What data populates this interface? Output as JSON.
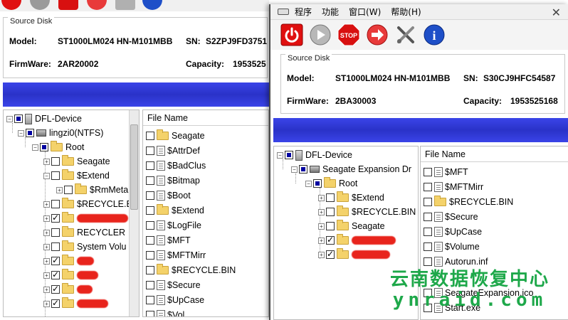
{
  "back_window": {
    "source_disk": {
      "legend": "Source Disk",
      "model_label": "Model:",
      "model_value": "ST1000LM024 HN-M101MBB",
      "sn_label": "SN:",
      "sn_value": "S2ZPJ9FD3751",
      "firmware_label": "FirmWare:",
      "firmware_value": "2AR20002",
      "capacity_label": "Capacity:",
      "capacity_value": "1953525"
    },
    "tree": {
      "device": "DFL-Device",
      "partition": "lingzi0(NTFS)",
      "root": "Root",
      "items": [
        "Seagate",
        "$Extend",
        "$RmMeta",
        "$RECYCLE.BIN",
        "RECYCLER",
        "System Volu"
      ]
    },
    "file_list": {
      "header": "File Name",
      "files": [
        "Seagate",
        "$AttrDef",
        "$BadClus",
        "$Bitmap",
        "$Boot",
        "$Extend",
        "$LogFile",
        "$MFT",
        "$MFTMirr",
        "$RECYCLE.BIN",
        "$Secure",
        "$UpCase",
        "$Vol"
      ]
    }
  },
  "front_window": {
    "menu": {
      "items": [
        "程序",
        "功能",
        "窗口(W)",
        "帮助(H)"
      ],
      "close": "✕"
    },
    "toolbar": {
      "stop_label": "STOP",
      "info_label": "i"
    },
    "source_disk": {
      "legend": "Source Disk",
      "model_label": "Model:",
      "model_value": "ST1000LM024 HN-M101MBB",
      "sn_label": "SN:",
      "sn_value": "S30CJ9HFC54587",
      "firmware_label": "FirmWare:",
      "firmware_value": "2BA30003",
      "capacity_label": "Capacity:",
      "capacity_value": "1953525168"
    },
    "tree": {
      "device": "DFL-Device",
      "partition": "Seagate Expansion Dr",
      "root": "Root",
      "items": [
        "$Extend",
        "$RECYCLE.BIN",
        "Seagate"
      ]
    },
    "file_list": {
      "header": "File Name",
      "files": [
        "$MFT",
        "$MFTMirr",
        "$RECYCLE.BIN",
        "$Secure",
        "$UpCase",
        "$Volume",
        "Autorun.inf",
        "SeagateExpansion.ico",
        "Start.exe"
      ]
    }
  },
  "watermark": {
    "cn": "云南数据恢复中心",
    "en": "ynraid.com"
  },
  "colors": {
    "blue_bar": "#2a32c8",
    "power_red": "#e01010",
    "stop_red": "#d81010",
    "info_blue": "#1e4fc8",
    "watermark_green": "#1ea84a"
  }
}
